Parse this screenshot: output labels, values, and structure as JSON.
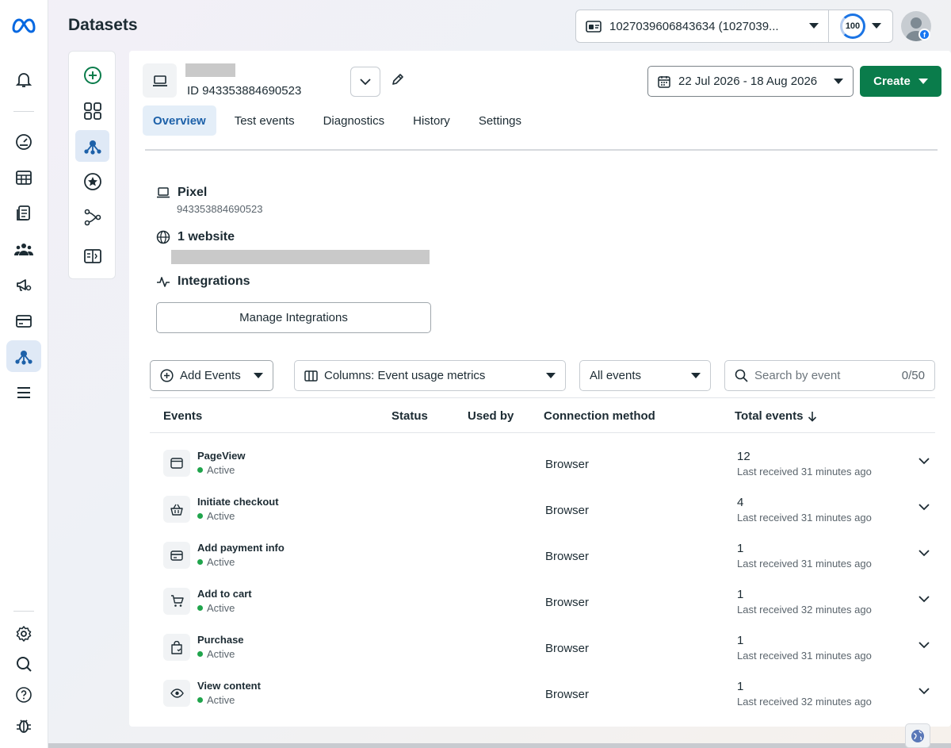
{
  "app": {
    "page_title": "Datasets"
  },
  "header": {
    "account_label": "1027039606843634 (1027039...",
    "score_value": "100"
  },
  "dataset": {
    "id_label": "ID 943353884690523",
    "date_range": "22 Jul 2026 - 18 Aug 2026",
    "create_label": "Create"
  },
  "tabs": [
    {
      "label": "Overview",
      "active": true
    },
    {
      "label": "Test events",
      "active": false
    },
    {
      "label": "Diagnostics",
      "active": false
    },
    {
      "label": "History",
      "active": false
    },
    {
      "label": "Settings",
      "active": false
    }
  ],
  "overview": {
    "pixel_title": "Pixel",
    "pixel_id": "943353884690523",
    "website_title": "1 website",
    "integrations_title": "Integrations",
    "manage_label": "Manage Integrations"
  },
  "toolbar": {
    "add_events_label": "Add Events",
    "columns_label": "Columns: Event usage metrics",
    "filter_label": "All events",
    "search_placeholder": "Search by event",
    "search_count": "0/50"
  },
  "table": {
    "columns": [
      "Events",
      "Status",
      "Used by",
      "Connection method",
      "Total events"
    ],
    "rows": [
      {
        "icon": "browser-window-icon",
        "name": "PageView",
        "status": "Active",
        "connection": "Browser",
        "total": "12",
        "last": "Last received 31 minutes ago"
      },
      {
        "icon": "basket-icon",
        "name": "Initiate checkout",
        "status": "Active",
        "connection": "Browser",
        "total": "4",
        "last": "Last received 31 minutes ago"
      },
      {
        "icon": "credit-card-icon",
        "name": "Add payment info",
        "status": "Active",
        "connection": "Browser",
        "total": "1",
        "last": "Last received 31 minutes ago"
      },
      {
        "icon": "cart-icon",
        "name": "Add to cart",
        "status": "Active",
        "connection": "Browser",
        "total": "1",
        "last": "Last received 32 minutes ago"
      },
      {
        "icon": "shopping-bag-icon",
        "name": "Purchase",
        "status": "Active",
        "connection": "Browser",
        "total": "1",
        "last": "Last received 31 minutes ago"
      },
      {
        "icon": "eye-icon",
        "name": "View content",
        "status": "Active",
        "connection": "Browser",
        "total": "1",
        "last": "Last received 32 minutes ago"
      }
    ]
  },
  "colors": {
    "accent": "#1d61a9",
    "create_button": "#0a7c4b",
    "active_dot": "#20a44c",
    "meta_blue": "#0668e1"
  }
}
